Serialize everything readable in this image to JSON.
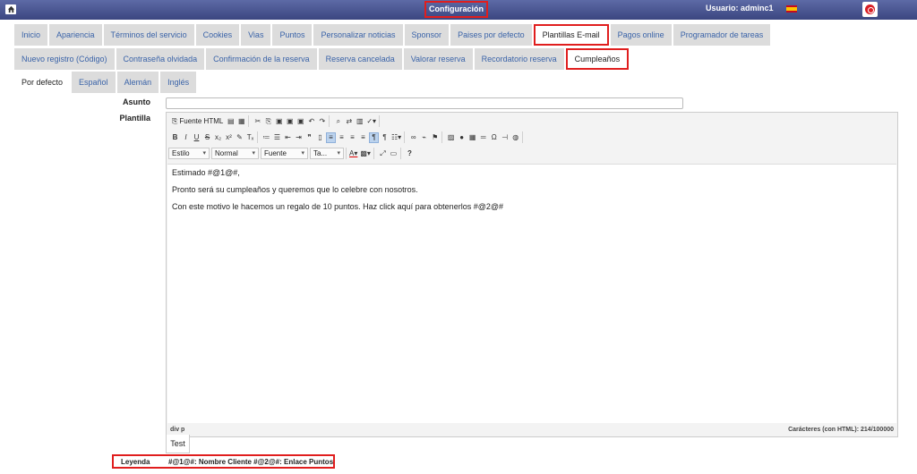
{
  "header": {
    "title": "Configuración",
    "user": "Usuario: adminc1",
    "home_icon": "home-icon",
    "flag_icon": "spain-flag-icon",
    "logout_icon": "power-icon"
  },
  "main_tabs": [
    "Inicio",
    "Apariencia",
    "Términos del servicio",
    "Cookies",
    "Vias",
    "Puntos",
    "Personalizar noticias",
    "Sponsor",
    "Paises por defecto",
    "Plantillas E-mail",
    "Pagos online",
    "Programador de tareas"
  ],
  "template_tabs": [
    "Nuevo registro (Código)",
    "Contraseña olvidada",
    "Confirmación de la reserva",
    "Reserva cancelada",
    "Valorar reserva",
    "Recordatorio reserva",
    "Cumpleaños"
  ],
  "lang_tabs": [
    "Por defecto",
    "Español",
    "Alemán",
    "Inglés"
  ],
  "form": {
    "asunto_label": "Asunto",
    "asunto_value": "",
    "plantilla_label": "Plantilla"
  },
  "editor": {
    "source_button": "Fuente HTML",
    "combos": [
      "Estilo",
      "Normal",
      "Fuente",
      "Ta..."
    ],
    "content_lines": [
      "Estimado #@1@#,",
      "Pronto será su cumpleaños y queremos que lo celebre con nosotros.",
      "Con este motivo le hacemos un regalo de 10 puntos. Haz click aquí para obtenerlos #@2@#"
    ],
    "path": "div  p",
    "char_count": "Carácteres (con HTML): 214/100000"
  },
  "test_tab": "Test",
  "legend": {
    "label": "Leyenda",
    "text": "#@1@#: Nombre Cliente    #@2@#: Enlace Puntos"
  },
  "colors": {
    "header": "#3b4680",
    "tab_bg": "#dcdcdc",
    "tab_text": "#3a63a8",
    "highlight": "#e01e1e"
  }
}
